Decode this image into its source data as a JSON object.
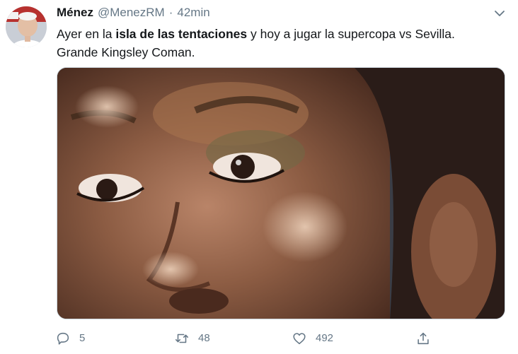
{
  "tweet": {
    "author_name": "Ménez",
    "author_handle": "@MenezRM",
    "separator": "·",
    "time": "42min",
    "text_before": "Ayer en la ",
    "text_bold": "isla de las tentaciones",
    "text_after": " y hoy a jugar la supercopa vs Sevilla.",
    "text_line2": "Grande Kingsley Coman.",
    "media_icon": "photo-of-face",
    "actions": {
      "reply_count": "5",
      "retweet_count": "48",
      "like_count": "492"
    }
  },
  "icons": {
    "caret": "chevron-down-icon",
    "reply": "reply-icon",
    "retweet": "retweet-icon",
    "like": "heart-icon",
    "share": "share-icon"
  },
  "colors": {
    "secondary_text": "#657786",
    "border": "#ccd6dd"
  }
}
